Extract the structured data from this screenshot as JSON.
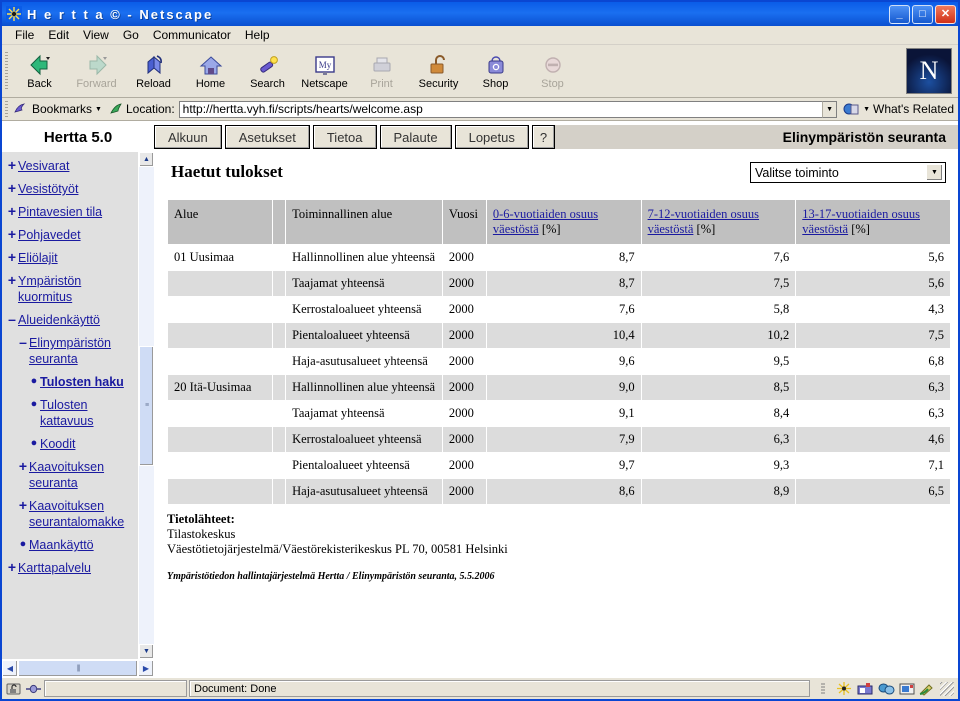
{
  "window": {
    "title": "H e r t t a © - Netscape",
    "minimize": "_",
    "maximize": "□",
    "close": "✕"
  },
  "menubar": [
    "File",
    "Edit",
    "View",
    "Go",
    "Communicator",
    "Help"
  ],
  "toolbar": [
    {
      "label": "Back",
      "icon": "back-icon",
      "enabled": true
    },
    {
      "label": "Forward",
      "icon": "forward-icon",
      "enabled": false
    },
    {
      "label": "Reload",
      "icon": "reload-icon",
      "enabled": true
    },
    {
      "label": "Home",
      "icon": "home-icon",
      "enabled": true
    },
    {
      "label": "Search",
      "icon": "search-icon",
      "enabled": true
    },
    {
      "label": "Netscape",
      "icon": "netscape-icon",
      "enabled": true
    },
    {
      "label": "Print",
      "icon": "print-icon",
      "enabled": false
    },
    {
      "label": "Security",
      "icon": "lock-icon",
      "enabled": true
    },
    {
      "label": "Shop",
      "icon": "shop-icon",
      "enabled": true
    },
    {
      "label": "Stop",
      "icon": "stop-icon",
      "enabled": false
    }
  ],
  "logo_letter": "N",
  "location": {
    "bookmarks_label": "Bookmarks",
    "location_label": "Location:",
    "url": "http://hertta.vyh.fi/scripts/hearts/welcome.asp",
    "whats_related": "What's Related"
  },
  "app": {
    "brand": "Hertta 5.0",
    "title": "Elinympäristön seuranta",
    "tabs": [
      "Alkuun",
      "Asetukset",
      "Tietoa",
      "Palaute",
      "Lopetus",
      "?"
    ]
  },
  "sidebar": {
    "items": [
      {
        "label": "Vesivarat",
        "marker": "+",
        "level": 1,
        "selected": false
      },
      {
        "label": "Vesistötyöt",
        "marker": "+",
        "level": 1,
        "selected": false
      },
      {
        "label": "Pintavesien tila",
        "marker": "+",
        "level": 1,
        "selected": false
      },
      {
        "label": "Pohjavedet",
        "marker": "+",
        "level": 1,
        "selected": false
      },
      {
        "label": "Eliölajit",
        "marker": "+",
        "level": 1,
        "selected": false
      },
      {
        "label": "Ympäristön kuormitus",
        "marker": "+",
        "level": 1,
        "selected": false
      },
      {
        "label": "Alueidenkäyttö",
        "marker": "–",
        "level": 1,
        "selected": false
      },
      {
        "label": "Elinympäristön seuranta",
        "marker": "–",
        "level": 2,
        "selected": false
      },
      {
        "label": "Tulosten haku",
        "marker": "●",
        "level": 3,
        "selected": true
      },
      {
        "label": "Tulosten kattavuus",
        "marker": "●",
        "level": 3,
        "selected": false
      },
      {
        "label": "Koodit",
        "marker": "●",
        "level": 3,
        "selected": false
      },
      {
        "label": "Kaavoituksen seuranta",
        "marker": "+",
        "level": 2,
        "selected": false
      },
      {
        "label": "Kaavoituksen seurantalomakke",
        "marker": "+",
        "level": 2,
        "selected": false
      },
      {
        "label": "Maankäyttö",
        "marker": "●",
        "level": 2,
        "selected": false
      },
      {
        "label": "Karttapalvelu",
        "marker": "+",
        "level": 1,
        "selected": false
      }
    ]
  },
  "main": {
    "heading": "Haetut tulokset",
    "action_select": {
      "value": "Valitse toiminto"
    },
    "table": {
      "headers": [
        {
          "text": "Alue",
          "link": false
        },
        {
          "text": "Toiminnallinen alue",
          "link": false
        },
        {
          "text": "Vuosi",
          "link": false
        },
        {
          "text": "0-6-vuotiaiden osuus väestöstä",
          "unit": "[%]",
          "link": true
        },
        {
          "text": "7-12-vuotiaiden osuus väestöstä",
          "unit": "[%]",
          "link": true
        },
        {
          "text": "13-17-vuotiaiden osuus väestöstä",
          "unit": "[%]",
          "link": true
        }
      ],
      "rows": [
        {
          "alue": "01 Uusimaa",
          "toiminnallinen": "Hallinnollinen alue yhteensä",
          "vuosi": "2000",
          "v1": "8,7",
          "v2": "7,6",
          "v3": "5,6",
          "shaded": false
        },
        {
          "alue": "",
          "toiminnallinen": "Taajamat yhteensä",
          "vuosi": "2000",
          "v1": "8,7",
          "v2": "7,5",
          "v3": "5,6",
          "shaded": true
        },
        {
          "alue": "",
          "toiminnallinen": "Kerrostaloalueet yhteensä",
          "vuosi": "2000",
          "v1": "7,6",
          "v2": "5,8",
          "v3": "4,3",
          "shaded": false
        },
        {
          "alue": "",
          "toiminnallinen": "Pientaloalueet yhteensä",
          "vuosi": "2000",
          "v1": "10,4",
          "v2": "10,2",
          "v3": "7,5",
          "shaded": true
        },
        {
          "alue": "",
          "toiminnallinen": "Haja-asutusalueet yhteensä",
          "vuosi": "2000",
          "v1": "9,6",
          "v2": "9,5",
          "v3": "6,8",
          "shaded": false
        },
        {
          "alue": "20 Itä-Uusimaa",
          "toiminnallinen": "Hallinnollinen alue yhteensä",
          "vuosi": "2000",
          "v1": "9,0",
          "v2": "8,5",
          "v3": "6,3",
          "shaded": true
        },
        {
          "alue": "",
          "toiminnallinen": "Taajamat yhteensä",
          "vuosi": "2000",
          "v1": "9,1",
          "v2": "8,4",
          "v3": "6,3",
          "shaded": false
        },
        {
          "alue": "",
          "toiminnallinen": "Kerrostaloalueet yhteensä",
          "vuosi": "2000",
          "v1": "7,9",
          "v2": "6,3",
          "v3": "4,6",
          "shaded": true
        },
        {
          "alue": "",
          "toiminnallinen": "Pientaloalueet yhteensä",
          "vuosi": "2000",
          "v1": "9,7",
          "v2": "9,3",
          "v3": "7,1",
          "shaded": false
        },
        {
          "alue": "",
          "toiminnallinen": "Haja-asutusalueet yhteensä",
          "vuosi": "2000",
          "v1": "8,6",
          "v2": "8,9",
          "v3": "6,5",
          "shaded": true
        }
      ]
    },
    "sources": {
      "title": "Tietolähteet:",
      "line1": "Tilastokeskus",
      "line2": "Väestötietojärjestelmä/Väestörekisterikeskus PL 70, 00581 Helsinki"
    },
    "footer_note": "Ympäristötiedon hallintajärjestelmä Hertta / Elinympäristön seuranta,  5.5.2006"
  },
  "status": {
    "document": "Document: Done"
  }
}
